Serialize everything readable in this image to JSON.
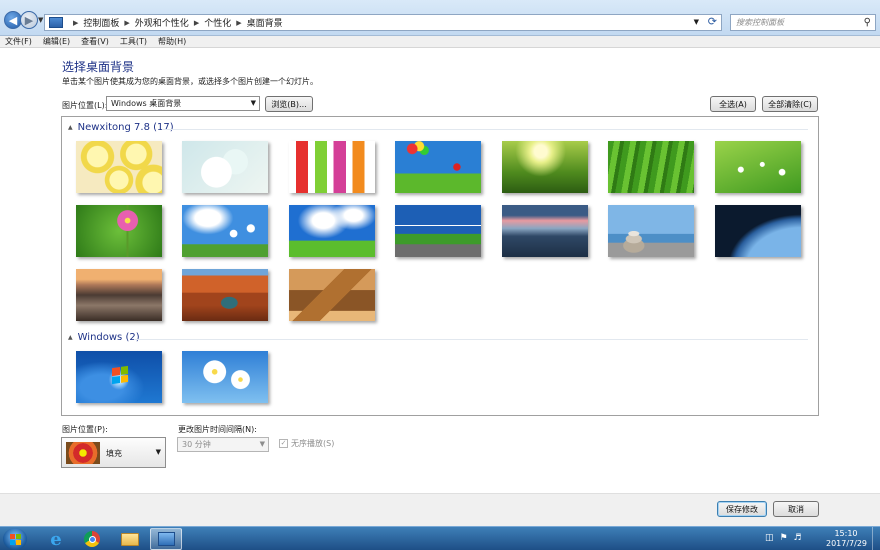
{
  "address_bar": {
    "breadcrumbs": [
      "控制面板",
      "外观和个性化",
      "个性化",
      "桌面背景"
    ],
    "search_placeholder": "搜索控制面板"
  },
  "menu": [
    "文件(F)",
    "编辑(E)",
    "查看(V)",
    "工具(T)",
    "帮助(H)"
  ],
  "header": {
    "title": "选择桌面背景",
    "description": "单击某个图片使其成为您的桌面背景，或选择多个图片创建一个幻灯片。"
  },
  "location": {
    "label": "图片位置(L):",
    "selected": "Windows 桌面背景",
    "browse": "浏览(B)...",
    "select_all": "全选(A)",
    "clear_all": "全部清除(C)"
  },
  "gallery": {
    "groups": [
      {
        "name": "Newxitong 7.8 (17)",
        "thumbs": [
          "lemon-slices",
          "ice-drink-mint",
          "popsicles",
          "balloons-jump",
          "sunlit-meadow",
          "green-leaves",
          "leaf-dewdrops",
          "pink-cosmos",
          "daisies-sky",
          "green-field-sky",
          "wind-turbine-road",
          "sunset-sea",
          "stacked-stones",
          "earth-from-space",
          "volcano-valley",
          "canyon-river",
          "desert-pyramids"
        ]
      },
      {
        "name": "Windows (2)",
        "thumbs": [
          "windows7-logo",
          "white-daisies"
        ]
      }
    ]
  },
  "options": {
    "position_label": "图片位置(P):",
    "position_value": "填充",
    "interval_label": "更改图片时间间隔(N):",
    "interval_value": "30 分钟",
    "shuffle_label": "无序播放(S)",
    "shuffle_checked": true
  },
  "footer": {
    "save": "保存修改",
    "cancel": "取消"
  },
  "taskbar": {
    "time": "15:10",
    "date": "2017/7/29"
  }
}
